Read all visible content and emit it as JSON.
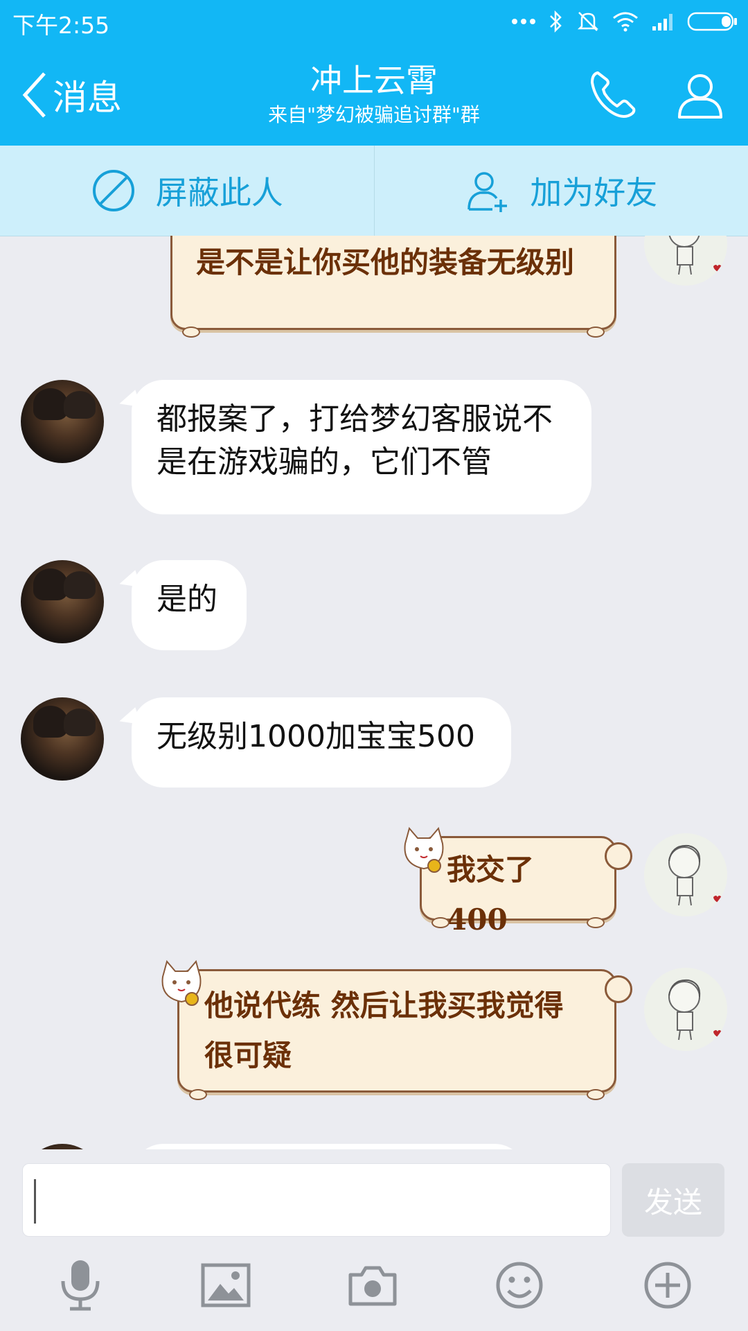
{
  "status_bar": {
    "time": "下午2:55",
    "icons": [
      "more-dots-icon",
      "bluetooth-icon",
      "mute-icon",
      "wifi-icon",
      "signal-icon",
      "battery-icon"
    ]
  },
  "header": {
    "back_label": "消息",
    "title": "冲上云霄",
    "subtitle": "来自\"梦幻被骗追讨群\"群",
    "icons": [
      "phone-icon",
      "profile-icon"
    ]
  },
  "action_bar": {
    "block_label": "屏蔽此人",
    "add_friend_label": "加为好友"
  },
  "messages": [
    {
      "sender": "self",
      "style": "scroll",
      "text": "是不是让你买他的装备无级别"
    },
    {
      "sender": "other",
      "style": "plain",
      "text": "都报案了，打给梦幻客服说不是在游戏骗的，它们不管"
    },
    {
      "sender": "other",
      "style": "plain",
      "text": "是的"
    },
    {
      "sender": "other",
      "style": "plain",
      "text": "无级别1000加宝宝500"
    },
    {
      "sender": "self",
      "style": "scroll",
      "text": "我交了400"
    },
    {
      "sender": "self",
      "style": "scroll",
      "text": "他说代练  然后让我买我觉得很可疑"
    }
  ],
  "input": {
    "value": "",
    "send_label": "发送"
  },
  "toolbar": [
    "microphone-icon",
    "image-icon",
    "camera-icon",
    "emoji-icon",
    "plus-icon"
  ],
  "colors": {
    "primary": "#12b7f5",
    "action_bar_bg": "#cdeffb",
    "chat_bg": "#ebecf1",
    "scroll_bubble_bg": "#fbf0dc",
    "scroll_text": "#6b3008"
  }
}
